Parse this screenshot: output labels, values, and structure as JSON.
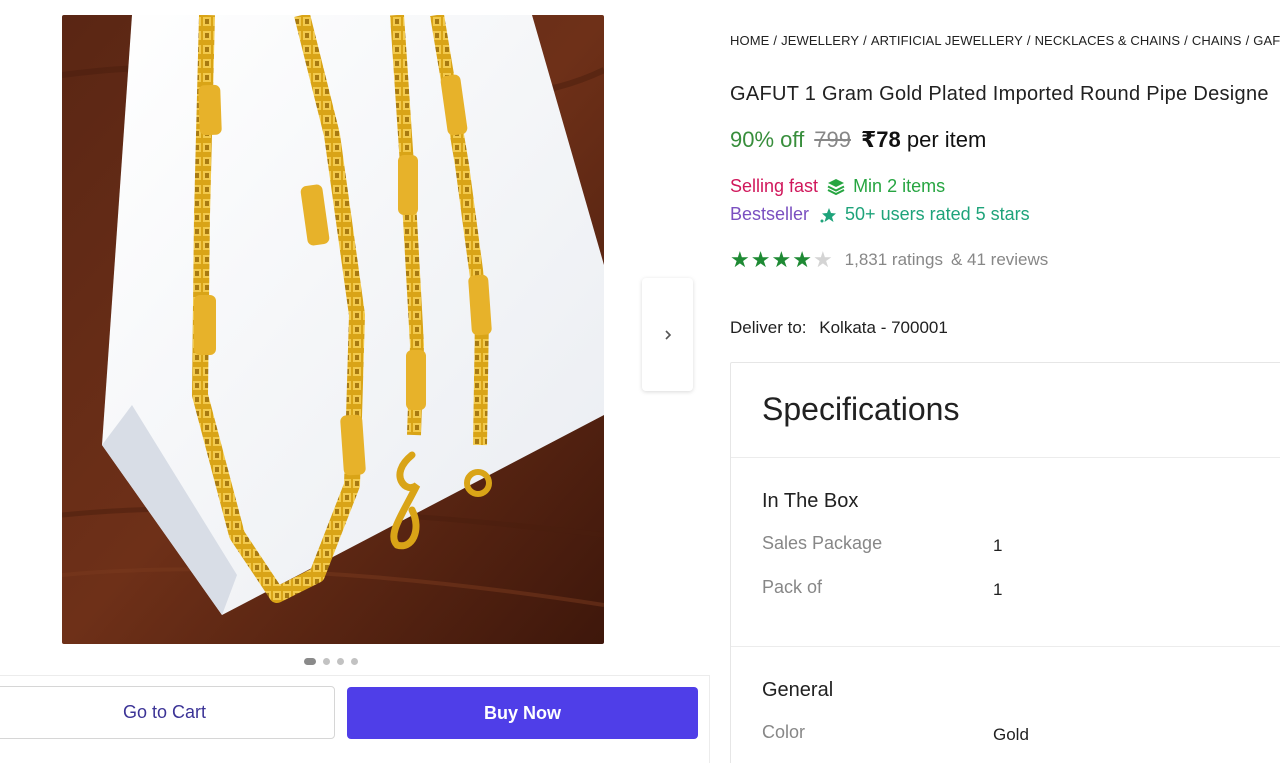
{
  "gallery": {
    "image_alt": "Gold plated round pipe chain on white paper over wooden table",
    "dots_total": 4,
    "dots_active_index": 0
  },
  "actions": {
    "cart_label": "Go to Cart",
    "buy_label": "Buy Now"
  },
  "breadcrumb": [
    "HOME",
    "JEWELLERY",
    "ARTIFICIAL JEWELLERY",
    "NECKLACES & CHAINS",
    "CHAINS",
    "GAFUT"
  ],
  "breadcrumb_separator": "/",
  "product": {
    "title": "GAFUT 1 Gram Gold Plated Imported Round Pipe Designe",
    "discount": "90% off",
    "mrp": "799",
    "price": "₹78",
    "price_suffix": "per item",
    "selling_fast": "Selling fast",
    "min_items": "Min 2 items",
    "bestseller": "Bestseller",
    "rated_text": "50+ users rated 5 stars",
    "rating_value": 4,
    "rating_max": 5,
    "ratings_count": "1,831 ratings",
    "reviews_count": "& 41 reviews"
  },
  "delivery": {
    "label": "Deliver to:",
    "location": "Kolkata - 700001"
  },
  "specifications": {
    "title": "Specifications",
    "groups": [
      {
        "name": "In The Box",
        "rows": [
          {
            "key": "Sales Package",
            "value": "1"
          },
          {
            "key": "Pack of",
            "value": "1"
          }
        ]
      },
      {
        "name": "General",
        "rows": [
          {
            "key": "Color",
            "value": "Gold"
          }
        ]
      }
    ]
  },
  "colors": {
    "discount": "#388e3c",
    "selling_fast": "#d0175b",
    "bestseller": "#7a4fc0",
    "buy_button": "#4f3ee8",
    "star": "#1e8a34"
  },
  "icons": {
    "next": "chevron-right-icon",
    "min_items": "stack-layers-icon",
    "rated": "star-sparkle-icon"
  }
}
